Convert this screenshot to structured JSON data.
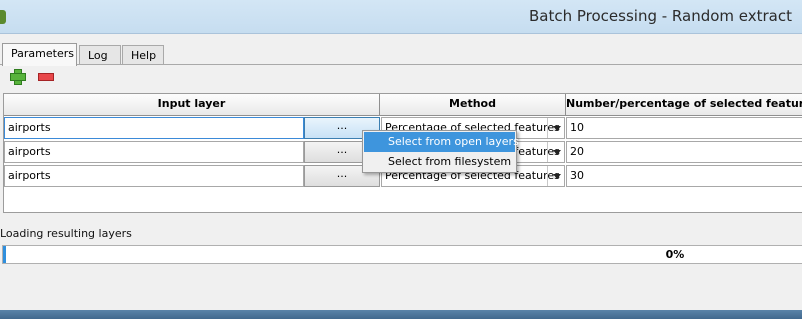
{
  "window": {
    "title": "Batch Processing - Random extract"
  },
  "tabs": [
    {
      "label": "Parameters",
      "active": true
    },
    {
      "label": "Log",
      "active": false
    },
    {
      "label": "Help",
      "active": false
    }
  ],
  "toolbar": {
    "add_icon": "plus-icon",
    "remove_icon": "minus-icon"
  },
  "table": {
    "headers": {
      "input_layer": "Input layer",
      "method": "Method",
      "number": "Number/percentage of selected features"
    },
    "rows": [
      {
        "input": "airports",
        "browse": "...",
        "method": "Percentage of selected features",
        "number": "10"
      },
      {
        "input": "airports",
        "browse": "...",
        "method": "Percentage of selected features",
        "number": "20"
      },
      {
        "input": "airports",
        "browse": "...",
        "method": "Percentage of selected features",
        "number": "30"
      }
    ]
  },
  "context_menu": {
    "items": [
      {
        "label": "Select from open layers",
        "highlighted": true
      },
      {
        "label": "Select from filesystem",
        "highlighted": false
      }
    ]
  },
  "status": {
    "text": "Loading resulting layers"
  },
  "progress": {
    "value": 0,
    "label": "0%"
  },
  "colors": {
    "accent": "#3e95dd",
    "titlebar": "#c6ddf0",
    "add": "#58b33c",
    "remove": "#e8474a"
  }
}
